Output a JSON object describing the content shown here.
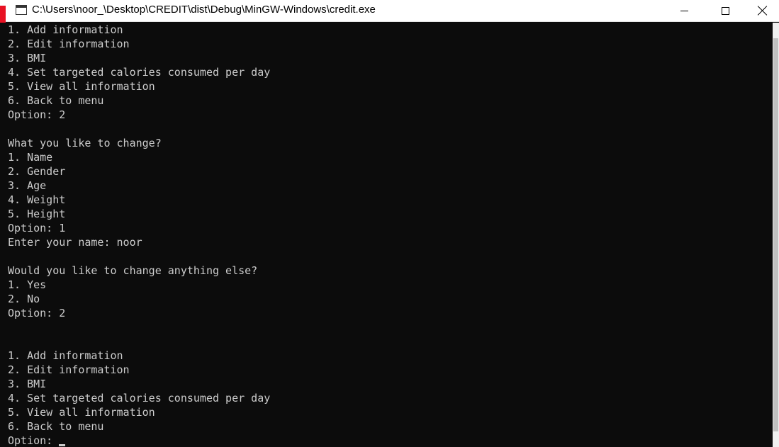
{
  "window": {
    "title": "C:\\Users\\noor_\\Desktop\\CREDIT\\dist\\Debug\\MinGW-Windows\\credit.exe",
    "controls": {
      "minimize_icon": "minimize-icon",
      "maximize_icon": "maximize-icon",
      "close_icon": "close-icon"
    }
  },
  "console": {
    "text_color": "#cccccc",
    "background": "#0c0c0c",
    "lines": [
      "1. Add information",
      "2. Edit information",
      "3. BMI",
      "4. Set targeted calories consumed per day",
      "5. View all information",
      "6. Back to menu",
      "Option: 2",
      "",
      "What you like to change?",
      "1. Name",
      "2. Gender",
      "3. Age",
      "4. Weight",
      "5. Height",
      "Option: 1",
      "Enter your name: noor",
      "",
      "Would you like to change anything else?",
      "1. Yes",
      "2. No",
      "Option: 2",
      "",
      "",
      "1. Add information",
      "2. Edit information",
      "3. BMI",
      "4. Set targeted calories consumed per day",
      "5. View all information",
      "6. Back to menu",
      "Option: "
    ]
  }
}
